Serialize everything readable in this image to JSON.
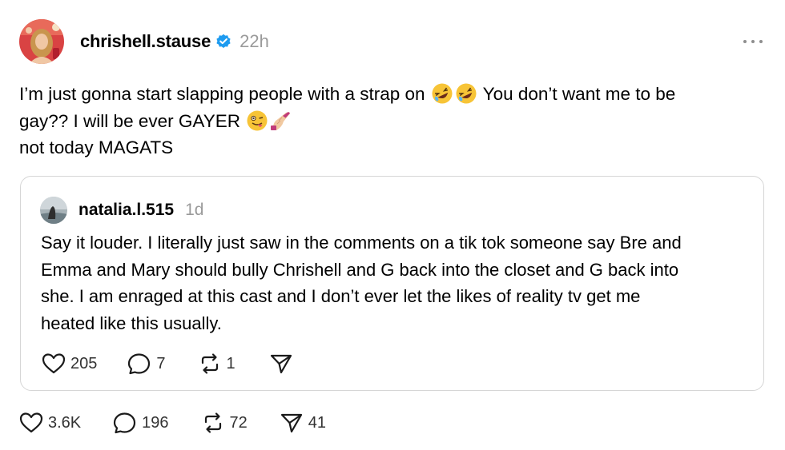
{
  "post": {
    "username": "chrishell.stause",
    "time": "22h",
    "text_lines": [
      "I’m just gonna start slapping people with a strap on",
      "You don’t want me to be",
      "gay?? I will be ever GAYER",
      "not today MAGATS"
    ],
    "emojis": [
      "rolling-on-floor-laughing-emoji",
      "rolling-on-floor-laughing-emoji",
      "winking-tongue-face-emoji",
      "nail-polish-emoji"
    ],
    "actions": {
      "likes": "3.6K",
      "replies": "196",
      "reposts": "72",
      "shares": "41"
    }
  },
  "quote": {
    "username": "natalia.l.515",
    "time": "1d",
    "text_lines": [
      "Say it louder. I literally just saw in the comments on a tik tok someone say Bre and",
      "Emma and Mary should bully Chrishell and G back into the closet and G back into",
      "she. I am enraged at this cast and I don’t ever let the likes of reality tv get me",
      "heated like this usually."
    ],
    "actions": {
      "likes": "205",
      "replies": "7",
      "reposts": "1"
    }
  },
  "colors": {
    "verified": "#1d9bf0",
    "muted": "#9a9a9a",
    "border": "#d6d6d6"
  }
}
